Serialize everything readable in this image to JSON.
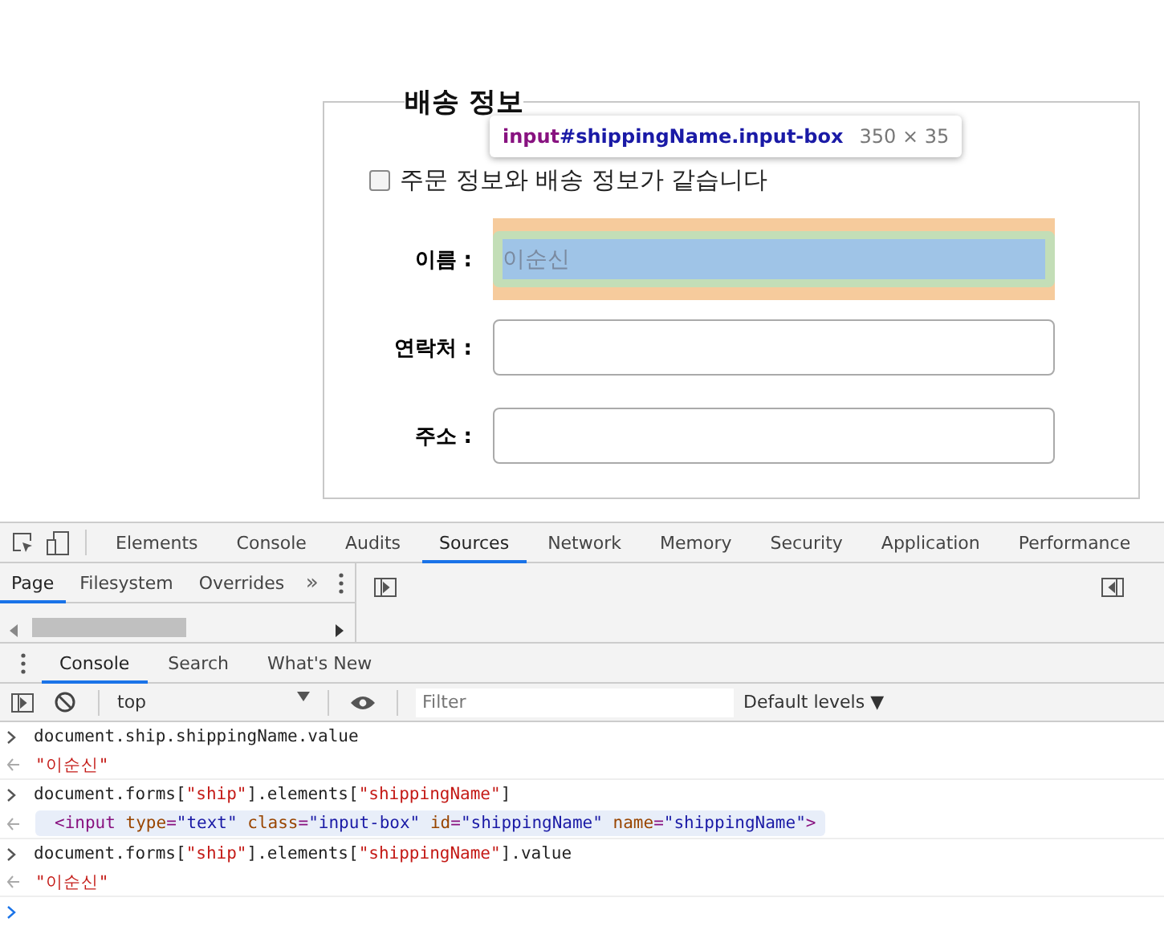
{
  "form": {
    "legend": "배송 정보",
    "same_as_order": {
      "label": "주문 정보와 배송 정보가 같습니다",
      "checked": false
    },
    "fields": [
      {
        "label": "이름 :",
        "value": "이순신",
        "highlighted": true
      },
      {
        "label": "연락처 :",
        "highlighted": false
      },
      {
        "label": "주소 :",
        "highlighted": false
      }
    ]
  },
  "tooltip": {
    "tag": "input",
    "selector": "#shippingName.input-box",
    "size": "350 × 35"
  },
  "devtools": {
    "tabs": [
      {
        "label": "Elements",
        "selected": false
      },
      {
        "label": "Console",
        "selected": false
      },
      {
        "label": "Audits",
        "selected": false
      },
      {
        "label": "Sources",
        "selected": true
      },
      {
        "label": "Network",
        "selected": false
      },
      {
        "label": "Memory",
        "selected": false
      },
      {
        "label": "Security",
        "selected": false
      },
      {
        "label": "Application",
        "selected": false
      },
      {
        "label": "Performance",
        "selected": false
      }
    ],
    "navigator_tabs": [
      {
        "label": "Page",
        "selected": true
      },
      {
        "label": "Filesystem",
        "selected": false
      },
      {
        "label": "Overrides",
        "selected": false
      }
    ],
    "more": "»",
    "drawer_tabs": [
      {
        "label": "Console",
        "selected": true
      },
      {
        "label": "Search",
        "selected": false
      },
      {
        "label": "What's New",
        "selected": false
      }
    ],
    "context": "top",
    "filter_placeholder": "Filter",
    "levels": "Default levels ▼",
    "entries": [
      {
        "kind": "input",
        "tokens": [
          {
            "t": "document.ship.shippingName.value",
            "kind": "plain"
          }
        ]
      },
      {
        "kind": "output",
        "tokens": [
          {
            "t": "\"이순신\"",
            "kind": "string"
          }
        ]
      },
      {
        "kind": "input",
        "tokens": [
          {
            "t": "document.forms[",
            "kind": "plain"
          },
          {
            "t": "\"ship\"",
            "kind": "string"
          },
          {
            "t": "].elements[",
            "kind": "plain"
          },
          {
            "t": "\"shippingName\"",
            "kind": "string"
          },
          {
            "t": "]",
            "kind": "plain"
          }
        ]
      },
      {
        "kind": "element",
        "tokens": [
          {
            "t": "<input ",
            "kind": "tag"
          },
          {
            "t": "type",
            "kind": "attr"
          },
          {
            "t": "=",
            "kind": "tag"
          },
          {
            "t": "\"text\"",
            "kind": "value"
          },
          {
            "t": " class",
            "kind": "attr"
          },
          {
            "t": "=",
            "kind": "tag"
          },
          {
            "t": "\"input-box\"",
            "kind": "value"
          },
          {
            "t": " id",
            "kind": "attr"
          },
          {
            "t": "=",
            "kind": "tag"
          },
          {
            "t": "\"shippingName\"",
            "kind": "value"
          },
          {
            "t": " name",
            "kind": "attr"
          },
          {
            "t": "=",
            "kind": "tag"
          },
          {
            "t": "\"shippingName\"",
            "kind": "value"
          },
          {
            "t": ">",
            "kind": "tag"
          }
        ]
      },
      {
        "kind": "input",
        "tokens": [
          {
            "t": "document.forms[",
            "kind": "plain"
          },
          {
            "t": "\"ship\"",
            "kind": "string"
          },
          {
            "t": "].elements[",
            "kind": "plain"
          },
          {
            "t": "\"shippingName\"",
            "kind": "string"
          },
          {
            "t": "].value",
            "kind": "plain"
          }
        ]
      },
      {
        "kind": "output",
        "tokens": [
          {
            "t": "\"이순신\"",
            "kind": "string"
          }
        ]
      }
    ]
  }
}
